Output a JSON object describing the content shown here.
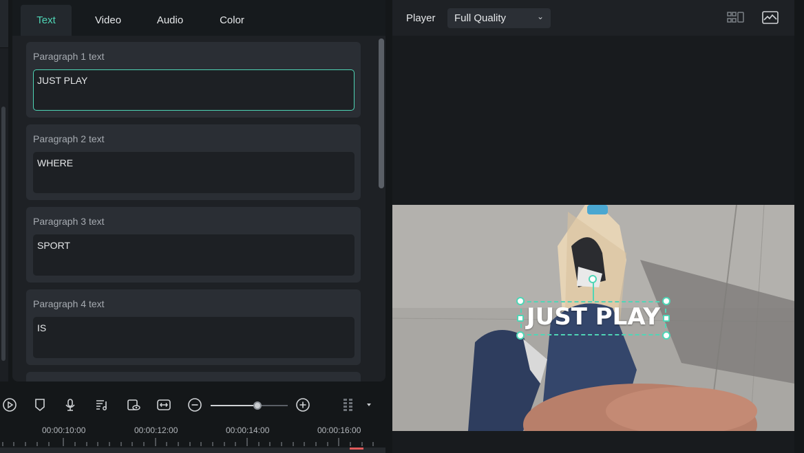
{
  "tabs": [
    {
      "label": "Text",
      "active": true
    },
    {
      "label": "Video",
      "active": false
    },
    {
      "label": "Audio",
      "active": false
    },
    {
      "label": "Color",
      "active": false
    }
  ],
  "paragraphs": [
    {
      "label": "Paragraph 1 text",
      "value": "JUST PLAY"
    },
    {
      "label": "Paragraph 2 text",
      "value": "WHERE"
    },
    {
      "label": "Paragraph 3 text",
      "value": "SPORT"
    },
    {
      "label": "Paragraph 4 text",
      "value": "IS"
    }
  ],
  "toolbar": {
    "icons": [
      "play-circle-icon",
      "marker-icon",
      "microphone-icon",
      "music-edit-icon",
      "preview-icon",
      "fit-width-icon",
      "zoom-out-icon",
      "zoom-in-icon",
      "grid-handle-icon",
      "dropdown-arrow-icon"
    ],
    "zoom_level": 0.6
  },
  "timeline": {
    "ticks": [
      "00:00:10:00",
      "00:00:12:00",
      "00:00:14:00",
      "00:00:16:00"
    ]
  },
  "player": {
    "label": "Player",
    "quality": "Full Quality",
    "icons": [
      "layout-grid-icon",
      "image-icon"
    ],
    "overlay_title": "JUST PLAY"
  },
  "colors": {
    "accent": "#4fd6b6",
    "background": "#141719",
    "panel": "#1e2125"
  }
}
